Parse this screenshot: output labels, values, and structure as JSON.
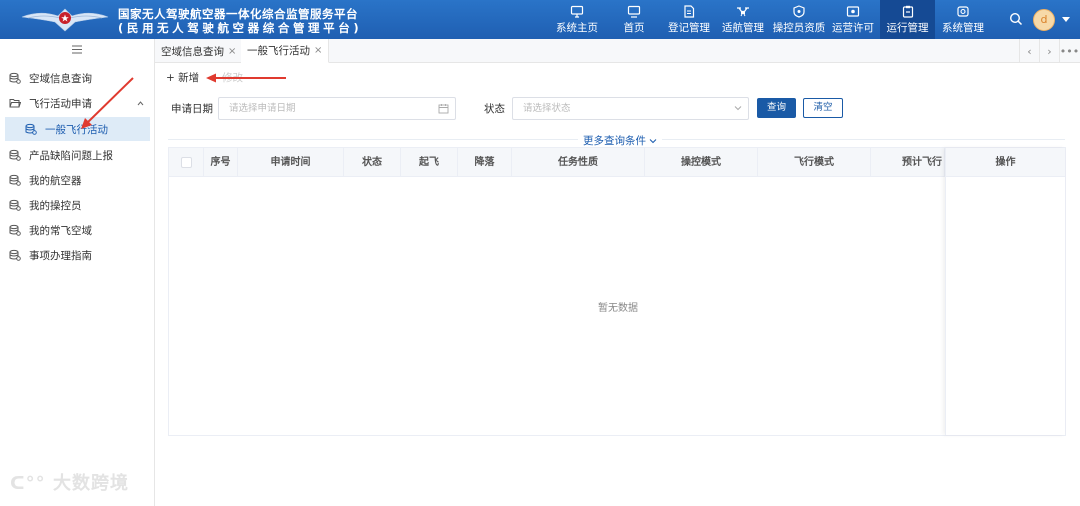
{
  "header": {
    "title_line1": "国家无人驾驶航空器一体化综合监管服务平台",
    "title_line2": "(民用无人驾驶航空器综合管理平台)",
    "nav": [
      {
        "label": "系统主页"
      },
      {
        "label": "首页"
      },
      {
        "label": "登记管理"
      },
      {
        "label": "适航管理"
      },
      {
        "label": "操控员资质"
      },
      {
        "label": "运营许可"
      },
      {
        "label": "运行管理",
        "active": true
      },
      {
        "label": "系统管理"
      }
    ],
    "avatar_letter": "d"
  },
  "sidebar": {
    "items": [
      {
        "label": "空域信息查询"
      },
      {
        "label": "飞行活动申请",
        "expanded": true
      },
      {
        "label": "一般飞行活动",
        "selected": true
      },
      {
        "label": "产品缺陷问题上报"
      },
      {
        "label": "我的航空器"
      },
      {
        "label": "我的操控员"
      },
      {
        "label": "我的常飞空域"
      },
      {
        "label": "事项办理指南"
      }
    ],
    "watermark": "大数跨境"
  },
  "tabs": [
    {
      "label": "空域信息查询",
      "close": "×"
    },
    {
      "label": "一般飞行活动",
      "close": "×",
      "active": true
    }
  ],
  "toolbar": {
    "add_label": "+ 新增",
    "delete_label": "修改"
  },
  "filters": {
    "date_label": "申请日期",
    "date_placeholder": "请选择申请日期",
    "status_label": "状态",
    "status_placeholder": "请选择状态",
    "query_label": "查询",
    "clear_label": "清空",
    "more_label": "更多查询条件"
  },
  "table": {
    "columns": [
      "序号",
      "申请时间",
      "状态",
      "起飞",
      "降落",
      "任务性质",
      "操控模式",
      "飞行模式",
      "预计飞行",
      "操作"
    ],
    "empty_text": "暂无数据"
  },
  "colors": {
    "header_bg": "#2a74c8",
    "active_nav": "#154a94",
    "primary": "#1a5aa6",
    "annotation": "#e03a2f"
  }
}
